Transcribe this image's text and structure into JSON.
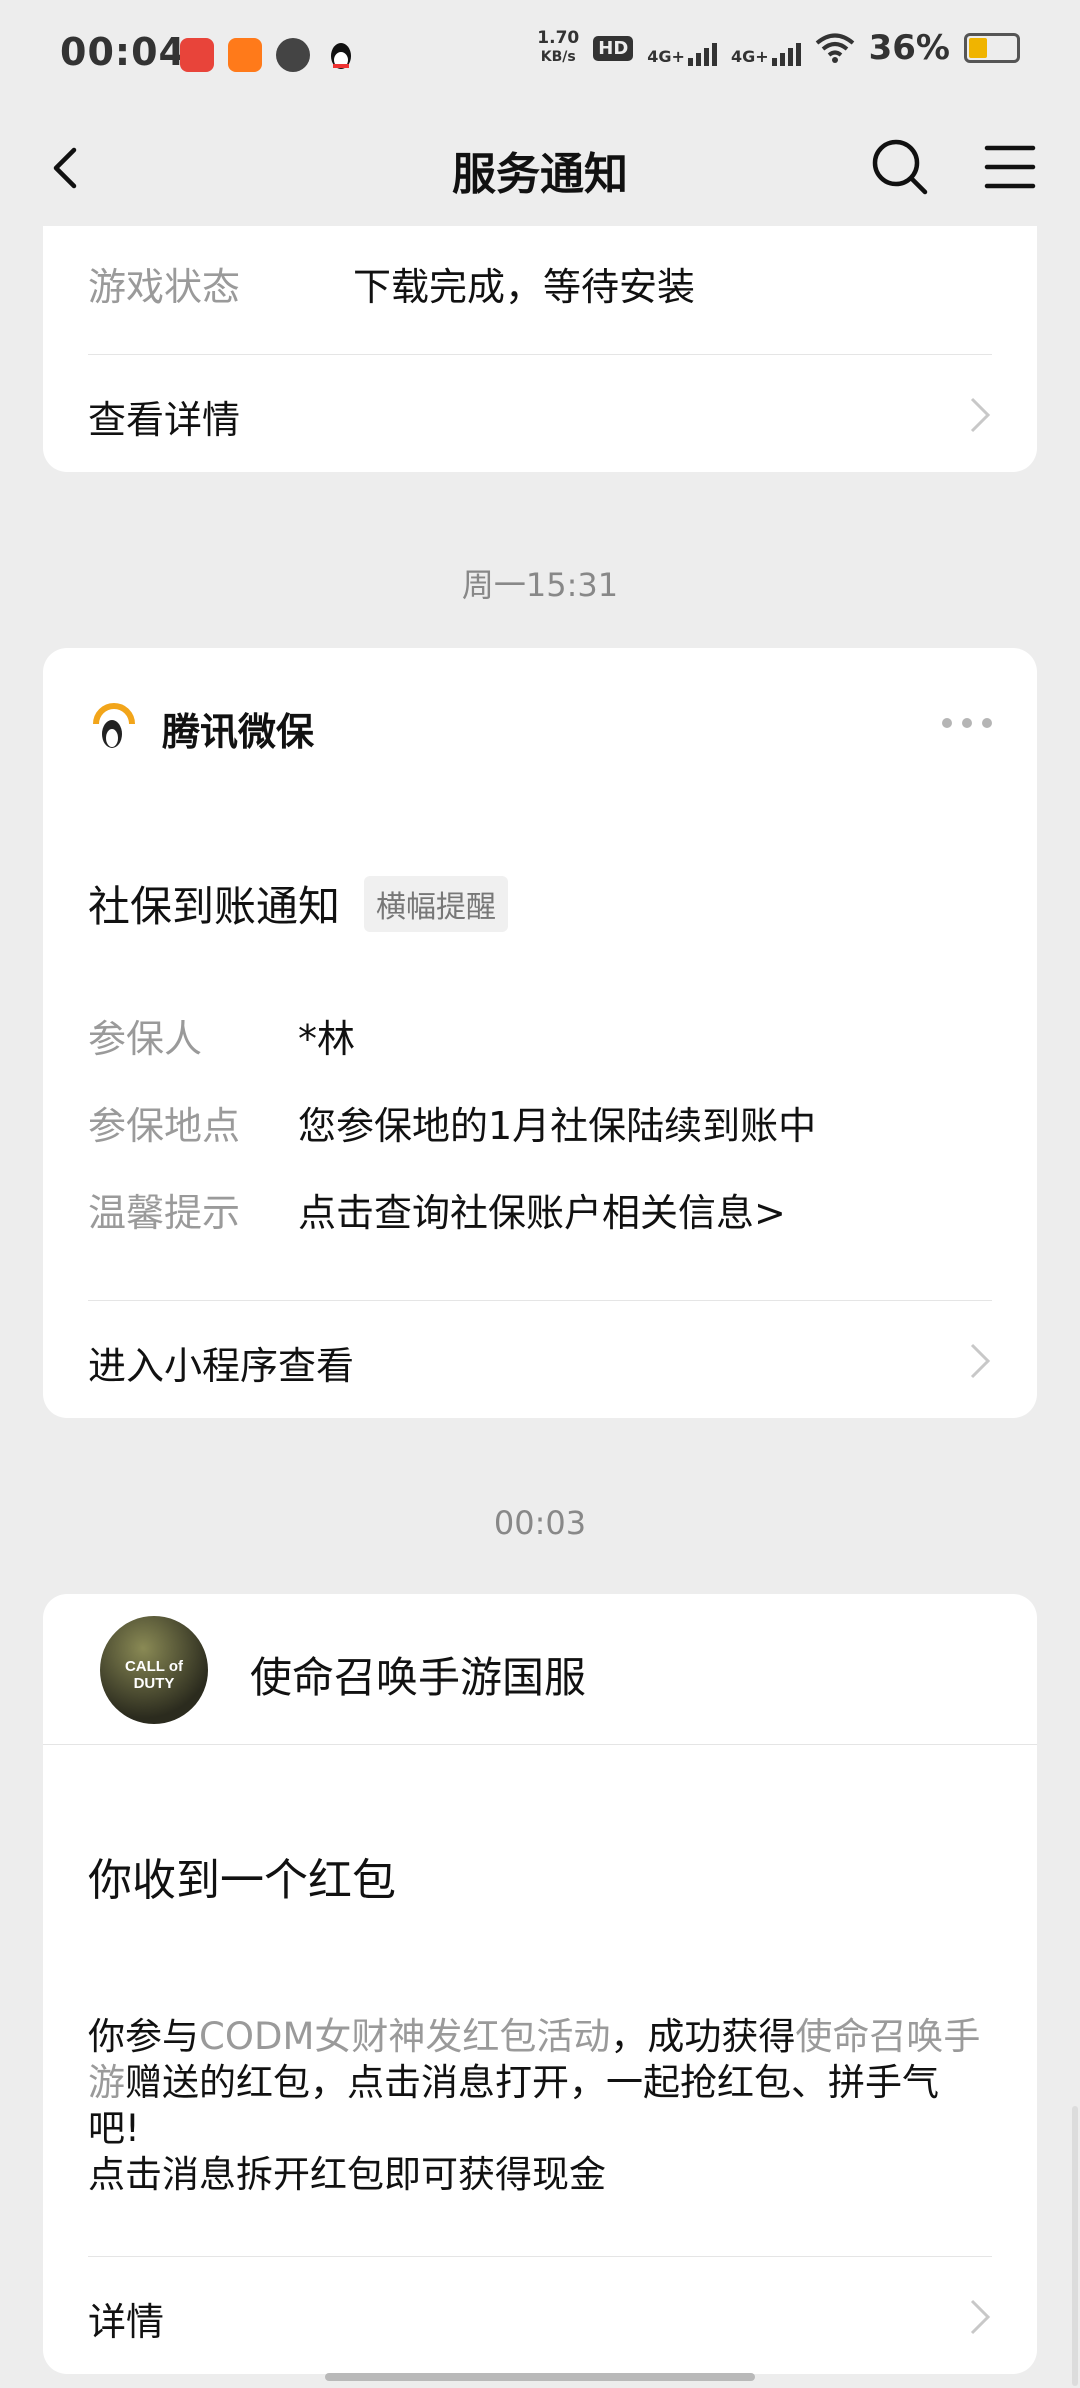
{
  "status_bar": {
    "time": "00:04",
    "speed_value": "1.70",
    "speed_unit": "KB/s",
    "hd_label": "HD",
    "sim1_label": "4G+",
    "sim2_label": "4G+",
    "battery_pct": "36%",
    "battery_level": 0.36,
    "app_icons": [
      "pinduoduo-icon",
      "taobao-icon",
      "message-icon",
      "qq-icon"
    ]
  },
  "nav": {
    "title": "服务通知",
    "back_icon": "back-arrow-icon",
    "search_icon": "search-icon",
    "menu_icon": "menu-icon"
  },
  "card1": {
    "field_label": "游戏状态",
    "field_value": "下载完成，等待安装",
    "link_label": "查看详情"
  },
  "timestamp1": "周一15:31",
  "card2": {
    "brand": "腾讯微保",
    "title": "社保到账通知",
    "badge": "横幅提醒",
    "rows": [
      {
        "label": "参保人",
        "value": "*林"
      },
      {
        "label": "参保地点",
        "value": "您参保地的1月社保陆续到账中"
      },
      {
        "label": "温馨提示",
        "value": "点击查询社保账户相关信息>"
      }
    ],
    "link_label": "进入小程序查看"
  },
  "timestamp2": "00:03",
  "card3": {
    "brand": "使命召唤手游国服",
    "avatar_text": "CALL of DUTY",
    "title": "你收到一个红包",
    "body_part1": "你参与",
    "body_hl1": "CODM女财神发红包活动",
    "body_part2": "，成功获得",
    "body_hl2": "使命召唤手游",
    "body_part3": "赠送的红包，点击消息打开，一起抢红包、拼手气吧!",
    "body_line2": "点击消息拆开红包即可获得现金",
    "link_label": "详情"
  },
  "colors": {
    "background": "#ededed",
    "card": "#ffffff",
    "muted_text": "#9a9a9a"
  }
}
